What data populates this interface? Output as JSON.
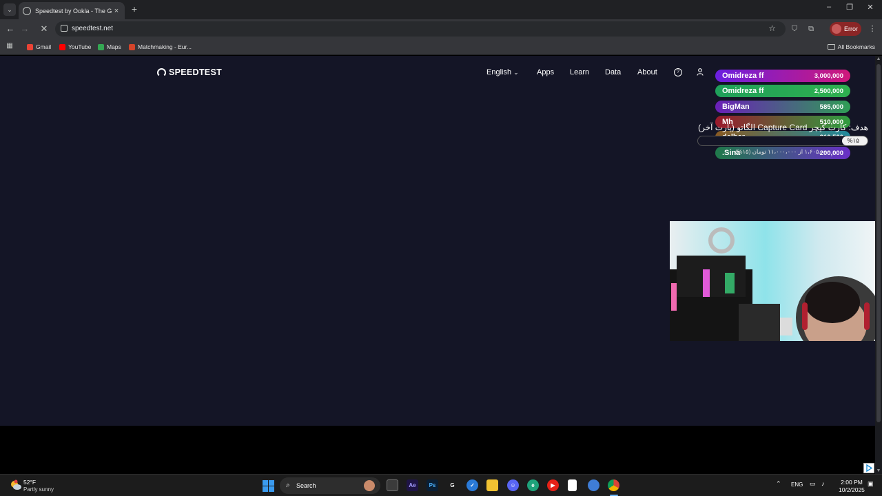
{
  "browser": {
    "tab_title": "Speedtest by Ookla - The Glob",
    "url": "speedtest.net",
    "profile_label": "Error",
    "bookmarks": [
      {
        "label": "Gmail",
        "color": "#ea4335"
      },
      {
        "label": "YouTube",
        "color": "#ff0000"
      },
      {
        "label": "Maps",
        "color": "#34a853"
      },
      {
        "label": "Matchmaking - Eur...",
        "color": "#d4442a"
      }
    ],
    "all_bookmarks_label": "All Bookmarks"
  },
  "site": {
    "logo_text": "SPEEDTEST",
    "nav": {
      "language": "English",
      "apps": "Apps",
      "learn": "Learn",
      "data": "Data",
      "about": "About"
    },
    "background_color": "#141526"
  },
  "stream_overlay": {
    "leaderboard": [
      {
        "name": "Omidreza ff",
        "amount": "3,000,000"
      },
      {
        "name": "Omidreza ff",
        "amount": "2,500,000"
      },
      {
        "name": "BigMan",
        "amount": "585,000"
      },
      {
        "name": "Mh",
        "amount": "510,000"
      },
      {
        "name": "delbar",
        "amount": "310,520"
      },
      {
        "name": ".Sina",
        "amount": "200,000"
      }
    ],
    "goal": {
      "title": "هدف: کارت کپچر Capture Card الگاتو (پارت آخر)",
      "percent_label": "%۱۵",
      "progress_fraction": 0.15,
      "subtitle": "۱،۶۰۵،۰۰۰ از ۱۱،۰۰۰،۰۰۰ تومان (۱۵%)"
    }
  },
  "taskbar": {
    "weather_temp": "52°F",
    "weather_desc": "Partly sunny",
    "search_placeholder": "Search",
    "language": "ENG",
    "time": "2:00 PM",
    "date": "10/2/2025"
  }
}
